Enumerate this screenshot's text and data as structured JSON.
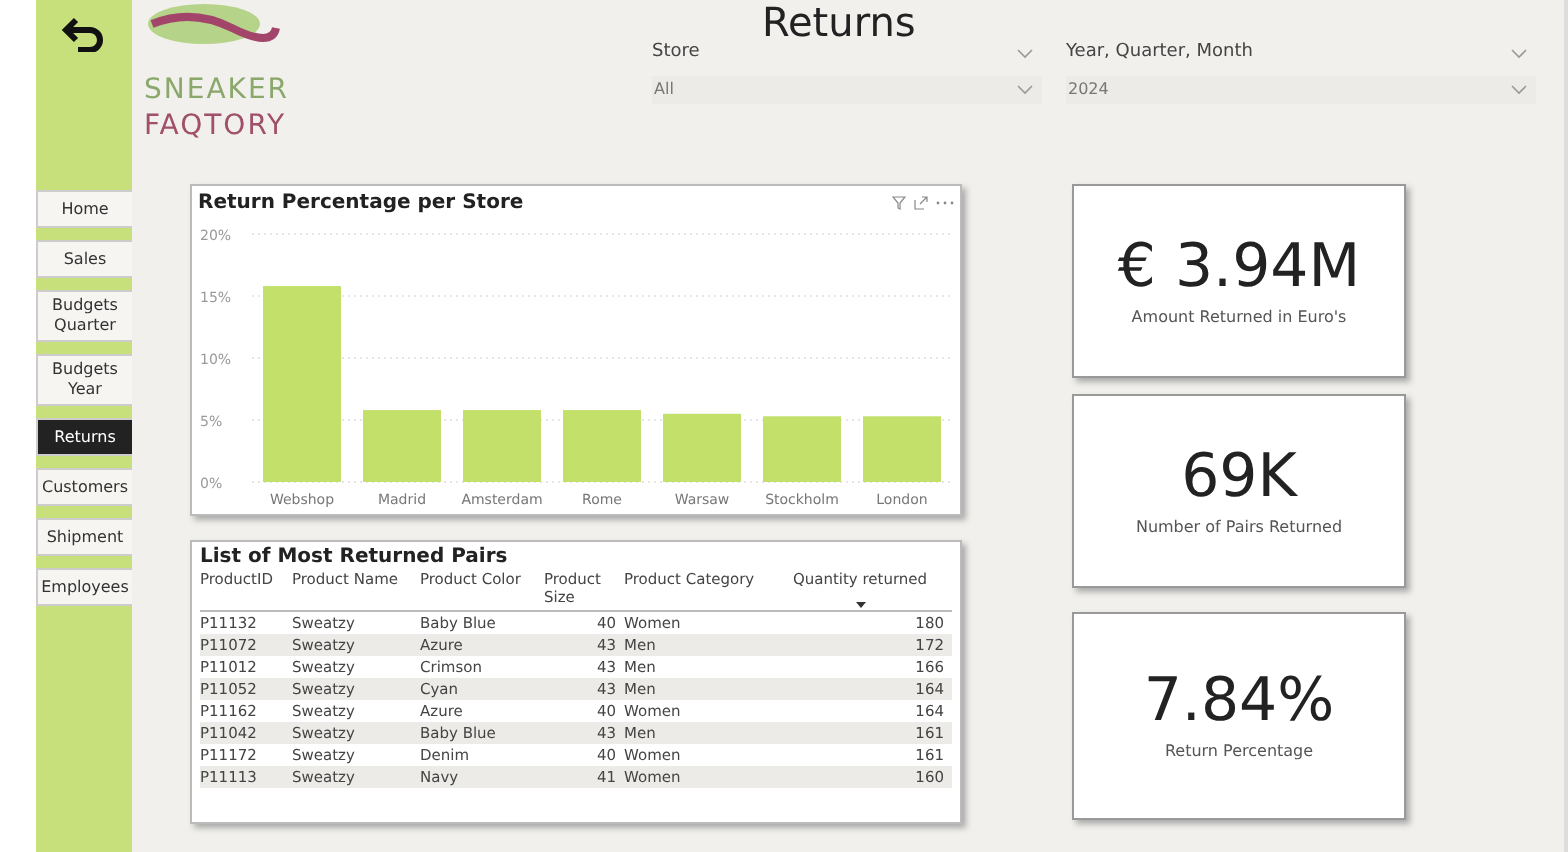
{
  "page_title": "Returns",
  "logo": {
    "line_1": "SNEAKER",
    "line_2": "FAQTORY"
  },
  "nav": [
    {
      "label": "Home",
      "selected": false
    },
    {
      "label": "Sales",
      "selected": false
    },
    {
      "label": "Budgets Quarter",
      "selected": false
    },
    {
      "label": "Budgets Year",
      "selected": false
    },
    {
      "label": "Returns",
      "selected": true
    },
    {
      "label": "Customers",
      "selected": false
    },
    {
      "label": "Shipment",
      "selected": false
    },
    {
      "label": "Employees",
      "selected": false
    }
  ],
  "filters": [
    {
      "label": "Store",
      "value": "All"
    },
    {
      "label": "Year, Quarter, Month",
      "value": "2024"
    }
  ],
  "bar_chart": {
    "title": "Return Percentage per Store",
    "chart_data": {
      "type": "bar",
      "categories": [
        "Webshop",
        "Madrid",
        "Amsterdam",
        "Rome",
        "Warsaw",
        "Stockholm",
        "London"
      ],
      "grid": true,
      "series": [
        {
          "color": "#c3e06a",
          "values": [
            15.8,
            5.8,
            5.8,
            5.8,
            5.5,
            5.3,
            5.3
          ]
        }
      ],
      "ylim": [
        0,
        20
      ],
      "yticks": [
        {
          "value": 0,
          "label": "0%"
        },
        {
          "value": 5,
          "label": "5%"
        },
        {
          "value": 10,
          "label": "10%"
        },
        {
          "value": 15,
          "label": "15%"
        },
        {
          "value": 20,
          "label": "20%"
        }
      ]
    }
  },
  "table": {
    "title": "List of Most Returned Pairs",
    "columns": [
      "ProductID",
      "Product Name",
      "Product Color",
      "Product Size",
      "Product Category",
      "Quantity returned"
    ],
    "rows": [
      [
        "P11132",
        "Sweatzy",
        "Baby Blue",
        "40",
        "Women",
        "180"
      ],
      [
        "P11072",
        "Sweatzy",
        "Azure",
        "43",
        "Men",
        "172"
      ],
      [
        "P11012",
        "Sweatzy",
        "Crimson",
        "43",
        "Men",
        "166"
      ],
      [
        "P11052",
        "Sweatzy",
        "Cyan",
        "43",
        "Men",
        "164"
      ],
      [
        "P11162",
        "Sweatzy",
        "Azure",
        "40",
        "Women",
        "164"
      ],
      [
        "P11042",
        "Sweatzy",
        "Baby Blue",
        "43",
        "Men",
        "161"
      ],
      [
        "P11172",
        "Sweatzy",
        "Denim",
        "40",
        "Women",
        "161"
      ],
      [
        "P11113",
        "Sweatzy",
        "Navy",
        "41",
        "Women",
        "160"
      ]
    ]
  },
  "kpis": [
    {
      "value": "€ 3.94M",
      "label": "Amount Returned in Euro's"
    },
    {
      "value": "69K",
      "label": "Number of Pairs Returned"
    },
    {
      "value": "7.84%",
      "label": "Return Percentage"
    }
  ]
}
